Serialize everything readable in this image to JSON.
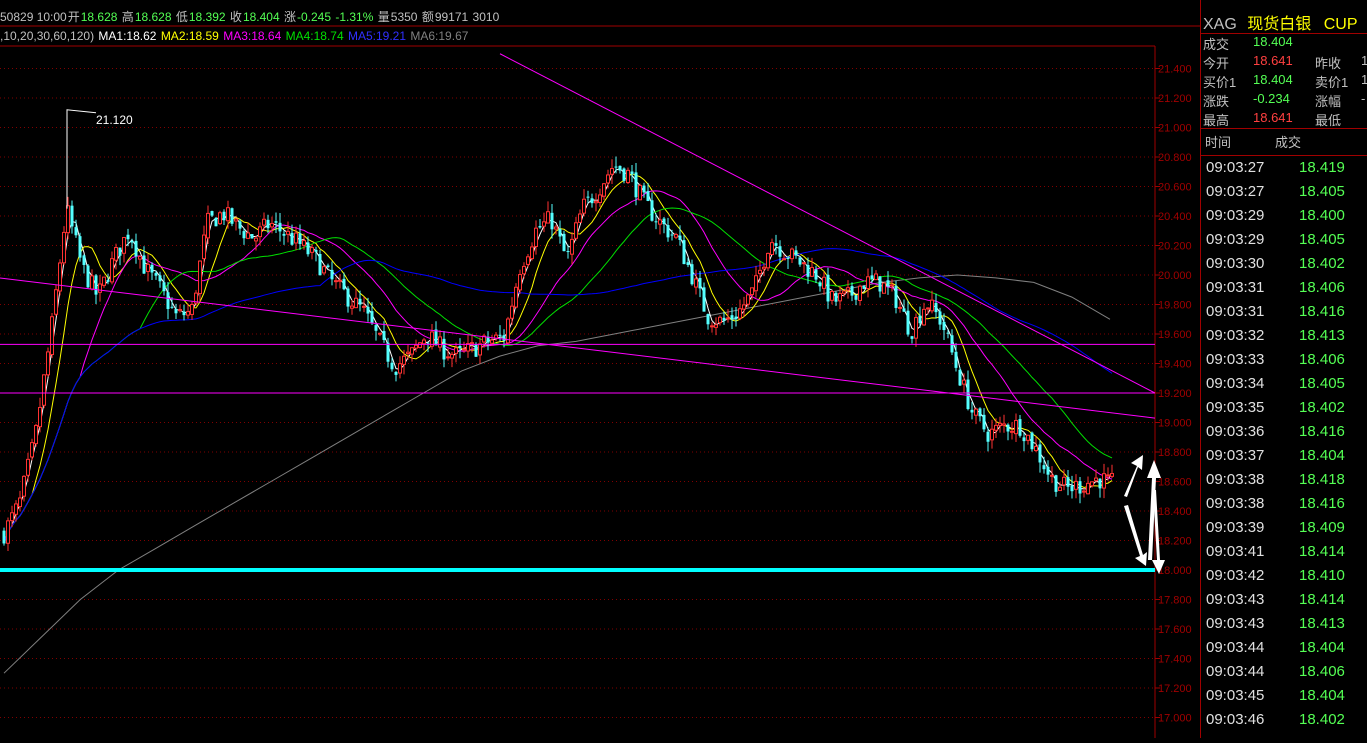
{
  "info_bar": {
    "date": "50829 10:00",
    "open_label": "开",
    "open": "18.628",
    "high_label": "高",
    "high": "18.628",
    "low_label": "低",
    "low": "18.392",
    "close_label": "收",
    "close": "18.404",
    "change_label": "涨",
    "change": "-0.245",
    "change_pct": "-1.31%",
    "volume_label": "量",
    "volume": "5350",
    "amount_label": "额",
    "amount": "99171",
    "extra": "3010"
  },
  "ma_bar": {
    "params": ",10,20,30,60,120)",
    "ma1": "MA1:18.62",
    "ma2": "MA2:18.59",
    "ma3": "MA3:18.64",
    "ma4": "MA4:18.74",
    "ma5": "MA5:19.21",
    "ma6": "MA6:19.67"
  },
  "colors": {
    "ma1": "#ffffff",
    "ma2": "#ffff00",
    "ma3": "#ff00ff",
    "ma4": "#00e000",
    "ma5": "#0000ff",
    "ma6": "#808080",
    "up": "#ff3232",
    "down": "#54ffff",
    "grid": "#800000",
    "axis": "#a00000",
    "support": "#00ffff",
    "trend": "#ff00ff"
  },
  "chart_data": {
    "type": "candlestick",
    "ylim": [
      17.0,
      21.5
    ],
    "y_ticks": [
      "21.400",
      "21.200",
      "21.000",
      "20.800",
      "20.600",
      "20.400",
      "20.200",
      "20.000",
      "19.800",
      "19.600",
      "19.400",
      "19.200",
      "19.000",
      "18.800",
      "18.600",
      "18.400",
      "18.200",
      "18.000",
      "17.800",
      "17.600",
      "17.400",
      "17.200",
      "17.000"
    ],
    "high_annotation": "21.120",
    "path": [
      18.25,
      18.45,
      18.9,
      19.6,
      20.45,
      20.05,
      19.85,
      20.1,
      20.3,
      20.05,
      19.9,
      19.72,
      19.75,
      20.35,
      20.42,
      20.32,
      20.25,
      20.35,
      20.28,
      20.2,
      20.1,
      19.95,
      19.85,
      19.75,
      19.55,
      19.38,
      19.45,
      19.6,
      19.5,
      19.45,
      19.5,
      19.55,
      19.58,
      20.05,
      20.3,
      20.38,
      20.1,
      20.45,
      20.58,
      20.75,
      20.68,
      20.48,
      20.35,
      20.25,
      20.0,
      19.72,
      19.68,
      19.75,
      19.9,
      20.25,
      20.15,
      20.08,
      20.0,
      19.82,
      19.85,
      19.95,
      19.95,
      19.85,
      19.62,
      19.82,
      19.68,
      19.35,
      19.05,
      18.92,
      18.98,
      18.98,
      18.82,
      18.62,
      18.55,
      18.58,
      18.62,
      18.58
    ],
    "ma6_path": [
      17.3,
      17.55,
      17.8,
      18.0,
      18.15,
      18.3,
      18.45,
      18.6,
      18.75,
      18.9,
      19.05,
      19.2,
      19.35,
      19.45,
      19.52,
      19.55,
      19.6,
      19.65,
      19.7,
      19.75,
      19.8,
      19.85,
      19.9,
      19.95,
      19.98,
      20.0,
      19.98,
      19.95,
      19.85,
      19.7
    ],
    "support_level": 18.0,
    "horizontal_lines": [
      19.53,
      19.2
    ]
  },
  "quote_panel": {
    "symbol": "XAG",
    "name": "现货白银",
    "currency": "CUP",
    "rows": [
      {
        "l1": "成交",
        "v1": "18.404",
        "l2": "",
        "v2": ""
      },
      {
        "l1": "今开",
        "v1": "18.641",
        "l2": "昨收",
        "v2": "1"
      },
      {
        "l1": "买价1",
        "v1": "18.404",
        "l2": "卖价1",
        "v2": "1"
      },
      {
        "l1": "涨跌",
        "v1": "-0.234",
        "l2": "涨幅",
        "v2": "-"
      },
      {
        "l1": "最高",
        "v1": "18.641",
        "l2": "最低",
        "v2": ""
      }
    ],
    "ticks_header": {
      "time": "时间",
      "price": "成交"
    },
    "ticks": [
      {
        "time": "09:03:27",
        "price": "18.419"
      },
      {
        "time": "09:03:27",
        "price": "18.405"
      },
      {
        "time": "09:03:29",
        "price": "18.400"
      },
      {
        "time": "09:03:29",
        "price": "18.405"
      },
      {
        "time": "09:03:30",
        "price": "18.402"
      },
      {
        "time": "09:03:31",
        "price": "18.406"
      },
      {
        "time": "09:03:31",
        "price": "18.416"
      },
      {
        "time": "09:03:32",
        "price": "18.413"
      },
      {
        "time": "09:03:33",
        "price": "18.406"
      },
      {
        "time": "09:03:34",
        "price": "18.405"
      },
      {
        "time": "09:03:35",
        "price": "18.402"
      },
      {
        "time": "09:03:36",
        "price": "18.416"
      },
      {
        "time": "09:03:37",
        "price": "18.404"
      },
      {
        "time": "09:03:38",
        "price": "18.418"
      },
      {
        "time": "09:03:38",
        "price": "18.416"
      },
      {
        "time": "09:03:39",
        "price": "18.409"
      },
      {
        "time": "09:03:41",
        "price": "18.414"
      },
      {
        "time": "09:03:42",
        "price": "18.410"
      },
      {
        "time": "09:03:43",
        "price": "18.414"
      },
      {
        "time": "09:03:43",
        "price": "18.413"
      },
      {
        "time": "09:03:44",
        "price": "18.404"
      },
      {
        "time": "09:03:44",
        "price": "18.406"
      },
      {
        "time": "09:03:45",
        "price": "18.404"
      },
      {
        "time": "09:03:46",
        "price": "18.402"
      }
    ]
  }
}
